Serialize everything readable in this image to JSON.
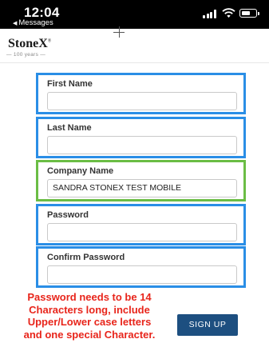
{
  "status_bar": {
    "time": "12:04",
    "back_label": "Messages",
    "back_arrow": "◀",
    "icons": [
      "signal-icon",
      "wifi-icon",
      "battery-icon"
    ]
  },
  "header": {
    "brand": "StoneX",
    "brand_mark": "®",
    "tagline": "— 100 years —"
  },
  "form": {
    "first_name": {
      "label": "First Name",
      "value": ""
    },
    "last_name": {
      "label": "Last Name",
      "value": ""
    },
    "company_name": {
      "label": "Company Name",
      "value": "SANDRA STONEX TEST MOBILE"
    },
    "password": {
      "label": "Password",
      "value": ""
    },
    "confirm_password": {
      "label": "Confirm Password",
      "value": ""
    }
  },
  "note": {
    "line1": "Password needs to be 14",
    "line2": "Characters long, include",
    "line3": "Upper/Lower case letters",
    "line4": "and one special Character."
  },
  "signup_label": "SIGN UP",
  "colors": {
    "status_bar_bg": "#000000",
    "field_border_blue": "#2a8ee6",
    "field_border_green": "#6bbd45",
    "note_text": "#e8251b",
    "signup_bg": "#1d4f80"
  }
}
